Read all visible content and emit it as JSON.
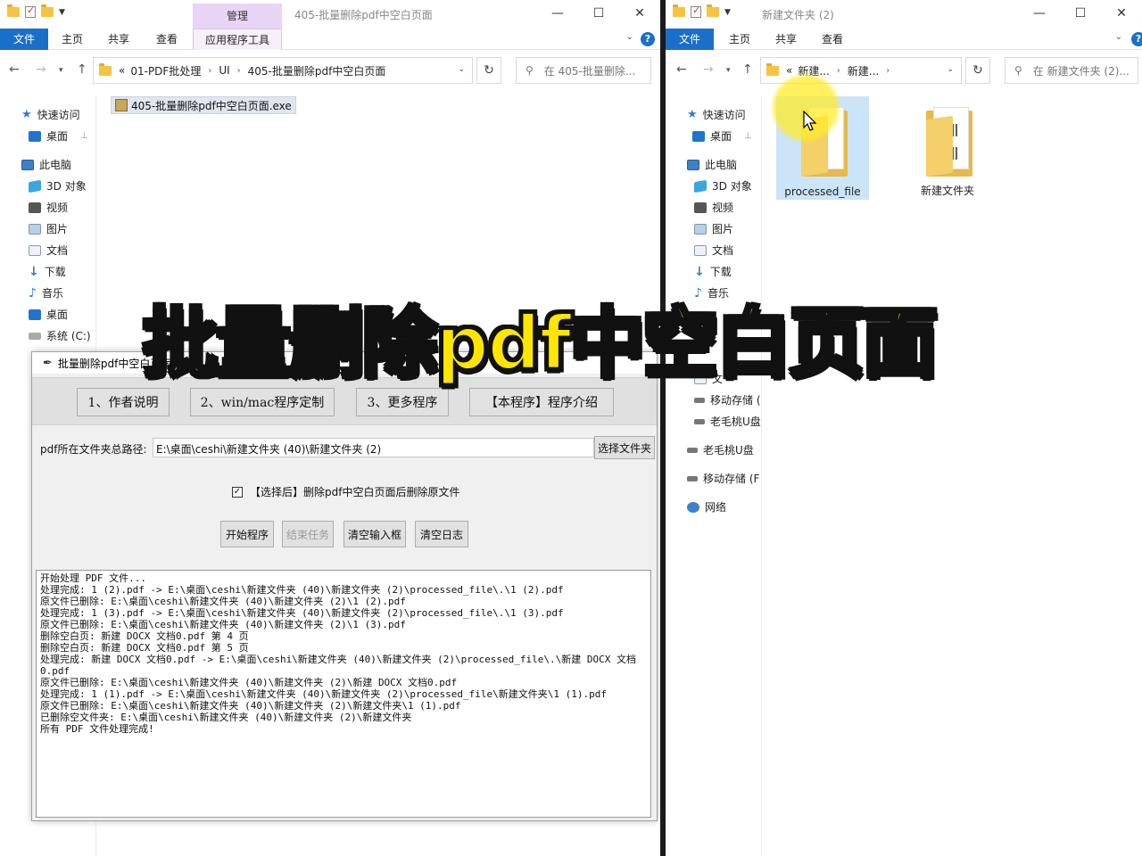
{
  "left_window": {
    "title": "405-批量删除pdf中空白页面",
    "context_tab_header": "管理",
    "ribbon_tabs": [
      "文件",
      "主页",
      "共享",
      "查看",
      "应用程序工具"
    ],
    "breadcrumb": [
      "01-PDF批处理",
      "UI",
      "405-批量删除pdf中空白页面"
    ],
    "breadcrumb_prefix": "«",
    "search_placeholder": "在 405-批量删除...",
    "file_name": "405-批量删除pdf中空白页面.exe"
  },
  "right_window": {
    "title": "新建文件夹 (2)",
    "ribbon_tabs": [
      "文件",
      "主页",
      "共享",
      "查看"
    ],
    "breadcrumb": [
      "新建...",
      "新建..."
    ],
    "breadcrumb_prefix": "«",
    "search_placeholder": "在 新建文件夹 (2)...",
    "folders": [
      "processed_file",
      "新建文件夹"
    ]
  },
  "nav_pane": {
    "quick_access": "快速访问",
    "desktop": "桌面",
    "this_pc": "此电脑",
    "objects_3d": "3D 对象",
    "videos": "视频",
    "pictures": "图片",
    "documents": "文档",
    "downloads": "下载",
    "music": "音乐",
    "desktop2": "桌面",
    "system_c": "系统 (C:)",
    "docs_partial": "文",
    "removable1": "移动存储 (",
    "usb1": "老毛桃U盘",
    "usb2": "老毛桃U盘",
    "removable2": "移动存储 (F",
    "network": "网络",
    "music_partial": "音乐"
  },
  "app": {
    "title": "批量删除pdf中空白页面",
    "tabs": [
      "1、作者说明",
      "2、win/mac程序定制",
      "3、更多程序",
      "【本程序】程序介绍"
    ],
    "path_label": "pdf所在文件夹总路径:",
    "path_value": "E:\\桌面\\ceshi\\新建文件夹 (40)\\新建文件夹 (2)",
    "choose_folder": "选择文件夹",
    "checkbox_label": "【选择后】删除pdf中空白页面后删除原文件",
    "checkbox_mark": "✓",
    "start": "开始程序",
    "stop": "结束任务",
    "clear_input": "清空输入框",
    "clear_log": "清空日志",
    "log": [
      "开始处理 PDF 文件...",
      "处理完成: 1 (2).pdf -> E:\\桌面\\ceshi\\新建文件夹 (40)\\新建文件夹 (2)\\processed_file\\.\\1 (2).pdf",
      "原文件已删除: E:\\桌面\\ceshi\\新建文件夹 (40)\\新建文件夹 (2)\\1 (2).pdf",
      "处理完成: 1 (3).pdf -> E:\\桌面\\ceshi\\新建文件夹 (40)\\新建文件夹 (2)\\processed_file\\.\\1 (3).pdf",
      "原文件已删除: E:\\桌面\\ceshi\\新建文件夹 (40)\\新建文件夹 (2)\\1 (3).pdf",
      "删除空白页: 新建 DOCX 文档0.pdf 第 4 页",
      "删除空白页: 新建 DOCX 文档0.pdf 第 5 页",
      "处理完成: 新建 DOCX 文档0.pdf -> E:\\桌面\\ceshi\\新建文件夹 (40)\\新建文件夹 (2)\\processed_file\\.\\新建 DOCX 文档0.pdf",
      "原文件已删除: E:\\桌面\\ceshi\\新建文件夹 (40)\\新建文件夹 (2)\\新建 DOCX 文档0.pdf",
      "处理完成: 1 (1).pdf -> E:\\桌面\\ceshi\\新建文件夹 (40)\\新建文件夹 (2)\\processed_file\\新建文件夹\\1 (1).pdf",
      "原文件已删除: E:\\桌面\\ceshi\\新建文件夹 (40)\\新建文件夹 (2)\\新建文件夹\\1 (1).pdf",
      "已删除空文件夹: E:\\桌面\\ceshi\\新建文件夹 (40)\\新建文件夹 (2)\\新建文件夹",
      "所有 PDF 文件处理完成!"
    ]
  },
  "banner_text": "批量删除pdf中空白页面",
  "icons": {
    "back": "←",
    "forward": "→",
    "up": "↑",
    "refresh": "↻",
    "search": "⚲",
    "minimize": "—",
    "maximize": "☐",
    "close": "✕",
    "help": "?",
    "chevron": "⌄",
    "feather": "✒",
    "pin": "📌"
  },
  "colors": {
    "accent": "#1a6fc9",
    "banner_fill": "#ffe600",
    "manage_tab": "#e8d5f5"
  }
}
